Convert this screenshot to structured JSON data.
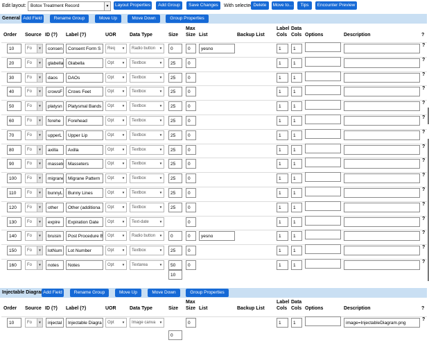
{
  "toolbar": {
    "edit_layout_label": "Edit layout:",
    "layout_value": "Botox Treatment Record",
    "layout_properties": "Layout Properties",
    "add_group": "Add Group",
    "save_changes": "Save Changes",
    "with_selected": "With selected",
    "delete": "Delete",
    "move_to": "Move to...",
    "tips": "Tips",
    "encounter_preview": "Encounter Preview"
  },
  "columns": {
    "order": "Order",
    "source": "Source",
    "id": "ID (?)",
    "label": "Label (?)",
    "uor": "UOR",
    "data_type": "Data Type",
    "size": "Size",
    "max_size_1": "Max",
    "max_size_2": "Size",
    "list": "List",
    "backup_list": "Backup List",
    "label_cols_1": "Label",
    "label_cols_2": "Cols",
    "data_cols_1": "Data",
    "data_cols_2": "Cols",
    "options": "Options",
    "description": "Description",
    "help": "?"
  },
  "groups": [
    {
      "name": "General",
      "buttons": {
        "add_field": "Add Field",
        "rename_group": "Rename Group",
        "move_up": "Move Up",
        "move_down": "Move Down",
        "group_properties": "Group Properties"
      },
      "rows": [
        {
          "order": "10",
          "source": "Fo",
          "id": "consen",
          "label": "Consent Form S",
          "uor": "Req",
          "data_type": "Radio button",
          "size": "0",
          "max_size": "0",
          "list": "yesno",
          "label_cols": "1",
          "data_cols": "1",
          "options": "",
          "description": "",
          "help": "?"
        },
        {
          "order": "20",
          "source": "Fo",
          "id": "glabella",
          "label": "Glabella",
          "uor": "Opt",
          "data_type": "Textbox",
          "size": "25",
          "max_size": "0",
          "list": "",
          "label_cols": "1",
          "data_cols": "1",
          "options": "",
          "description": "",
          "help": "?"
        },
        {
          "order": "30",
          "source": "Fo",
          "id": "daos",
          "label": "DAOs",
          "uor": "Opt",
          "data_type": "Textbox",
          "size": "25",
          "max_size": "0",
          "list": "",
          "label_cols": "1",
          "data_cols": "1",
          "options": "",
          "description": "",
          "help": "?"
        },
        {
          "order": "40",
          "source": "Fo",
          "id": "crowsF",
          "label": "Crows Feet",
          "uor": "Opt",
          "data_type": "Textbox",
          "size": "25",
          "max_size": "0",
          "list": "",
          "label_cols": "1",
          "data_cols": "1",
          "options": "",
          "description": "",
          "help": "?"
        },
        {
          "order": "50",
          "source": "Fo",
          "id": "platysn",
          "label": "Platysmal Bands",
          "uor": "Opt",
          "data_type": "Textbox",
          "size": "25",
          "max_size": "0",
          "list": "",
          "label_cols": "1",
          "data_cols": "1",
          "options": "",
          "description": "",
          "help": "?"
        },
        {
          "order": "60",
          "source": "Fo",
          "id": "forehe",
          "label": "Forehead",
          "uor": "Opt",
          "data_type": "Textbox",
          "size": "25",
          "max_size": "0",
          "list": "",
          "label_cols": "1",
          "data_cols": "1",
          "options": "",
          "description": "",
          "help": "?"
        },
        {
          "order": "70",
          "source": "Fo",
          "id": "upperL",
          "label": "Upper Lip",
          "uor": "Opt",
          "data_type": "Textbox",
          "size": "25",
          "max_size": "0",
          "list": "",
          "label_cols": "1",
          "data_cols": "1",
          "options": "",
          "description": "",
          "help": "?"
        },
        {
          "order": "80",
          "source": "Fo",
          "id": "axilla",
          "label": "Axilla",
          "uor": "Opt",
          "data_type": "Textbox",
          "size": "25",
          "max_size": "0",
          "list": "",
          "label_cols": "1",
          "data_cols": "1",
          "options": "",
          "description": "",
          "help": "?"
        },
        {
          "order": "90",
          "source": "Fo",
          "id": "massete",
          "label": "Masseters",
          "uor": "Opt",
          "data_type": "Textbox",
          "size": "25",
          "max_size": "0",
          "list": "",
          "label_cols": "1",
          "data_cols": "1",
          "options": "",
          "description": "",
          "help": "?"
        },
        {
          "order": "100",
          "source": "Fo",
          "id": "migrane",
          "label": "Migrane Pattern",
          "uor": "Opt",
          "data_type": "Textbox",
          "size": "25",
          "max_size": "0",
          "list": "",
          "label_cols": "1",
          "data_cols": "1",
          "options": "",
          "description": "",
          "help": "?"
        },
        {
          "order": "110",
          "source": "Fo",
          "id": "bunnyL",
          "label": "Bunny Lines",
          "uor": "Opt",
          "data_type": "Textbox",
          "size": "25",
          "max_size": "0",
          "list": "",
          "label_cols": "1",
          "data_cols": "1",
          "options": "",
          "description": "",
          "help": "?"
        },
        {
          "order": "120",
          "source": "Fo",
          "id": "other",
          "label": "Other (additiona",
          "uor": "Opt",
          "data_type": "Textbox",
          "size": "25",
          "max_size": "0",
          "list": "",
          "label_cols": "1",
          "data_cols": "1",
          "options": "",
          "description": "",
          "help": "?"
        },
        {
          "order": "130",
          "source": "Fo",
          "id": "expire",
          "label": "Expiration Date",
          "uor": "Opt",
          "data_type": "Text-date",
          "size": "",
          "max_size": "0",
          "list": "",
          "label_cols": "1",
          "data_cols": "1",
          "options": "",
          "description": "",
          "help": "?"
        },
        {
          "order": "140",
          "source": "Fo",
          "id": "bruisin",
          "label": "Post Procedure B",
          "uor": "Opt",
          "data_type": "Radio button",
          "size": "0",
          "max_size": "0",
          "list": "yesno",
          "label_cols": "1",
          "data_cols": "1",
          "options": "",
          "description": "",
          "help": "?"
        },
        {
          "order": "150",
          "source": "Fo",
          "id": "lotNum",
          "label": "Lot Number",
          "uor": "Opt",
          "data_type": "Textbox",
          "size": "25",
          "max_size": "0",
          "list": "",
          "label_cols": "1",
          "data_cols": "1",
          "options": "",
          "description": "",
          "help": "?"
        },
        {
          "order": "160",
          "source": "Fo",
          "id": "notes",
          "label": "Notes",
          "uor": "Opt",
          "data_type": "Textarea",
          "size": "50",
          "size_rows": "10",
          "max_size": "0",
          "list": "",
          "label_cols": "1",
          "data_cols": "1",
          "options": "",
          "description": "",
          "help": "?"
        }
      ]
    },
    {
      "name": "Injectable Diagram",
      "buttons": {
        "add_field": "Add Field",
        "rename_group": "Rename Group",
        "move_up": "Move Up",
        "move_down": "Move Down",
        "group_properties": "Group Properties"
      },
      "rows": [
        {
          "order": "10",
          "source": "Fo",
          "id": "injectal",
          "label": "Injectable Diagra",
          "uor": "Opt",
          "data_type": "Image canva",
          "size": "",
          "size_rows": "0",
          "max_size": "0",
          "list": "",
          "label_cols": "1",
          "data_cols": "1",
          "options": "",
          "description": "image=InjectableDiagram.png",
          "help": "?"
        }
      ]
    }
  ]
}
